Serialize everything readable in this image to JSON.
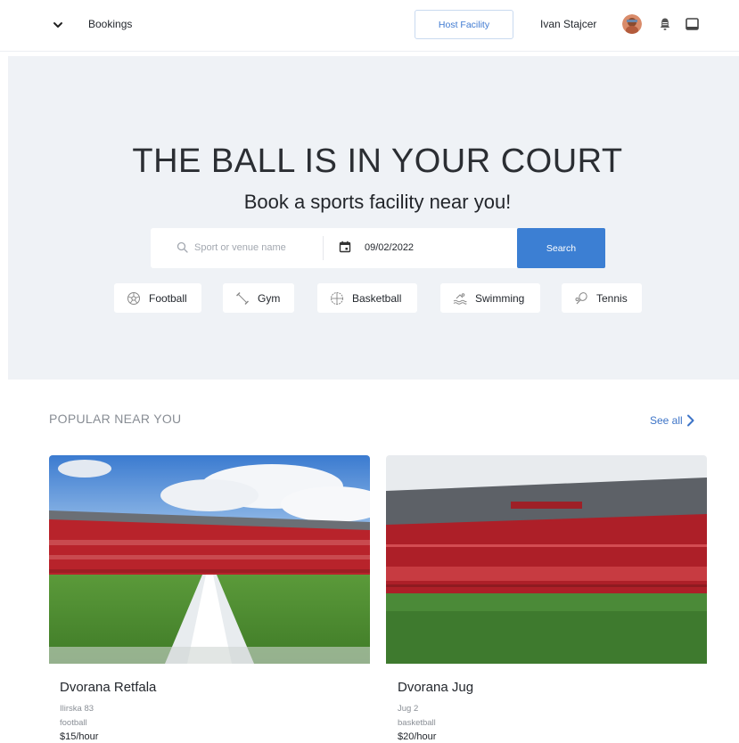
{
  "header": {
    "nav_label": "Bookings",
    "host_button": "Host Facility",
    "user_name": "Ivan Stajcer"
  },
  "hero": {
    "title": "THE BALL IS IN YOUR COURT",
    "subtitle": "Book a sports facility near you!",
    "search_placeholder": "Sport or venue name",
    "date_value": "09/02/2022",
    "search_button": "Search",
    "categories": [
      {
        "label": "Football",
        "icon": "football-icon"
      },
      {
        "label": "Gym",
        "icon": "gym-icon"
      },
      {
        "label": "Basketball",
        "icon": "basketball-icon"
      },
      {
        "label": "Swimming",
        "icon": "swimming-icon"
      },
      {
        "label": "Tennis",
        "icon": "tennis-icon"
      }
    ]
  },
  "popular": {
    "title": "POPULAR NEAR YOU",
    "see_all": "See all",
    "venues": [
      {
        "name": "Dvorana Retfala",
        "address": "Ilirska 83",
        "sport": "football",
        "price": "$15/hour"
      },
      {
        "name": "Dvorana Jug",
        "address": "Jug 2",
        "sport": "basketball",
        "price": "$20/hour"
      }
    ]
  },
  "colors": {
    "accent": "#3c7fd3",
    "hero_bg": "#eff2f6",
    "link": "#3d74c7"
  }
}
